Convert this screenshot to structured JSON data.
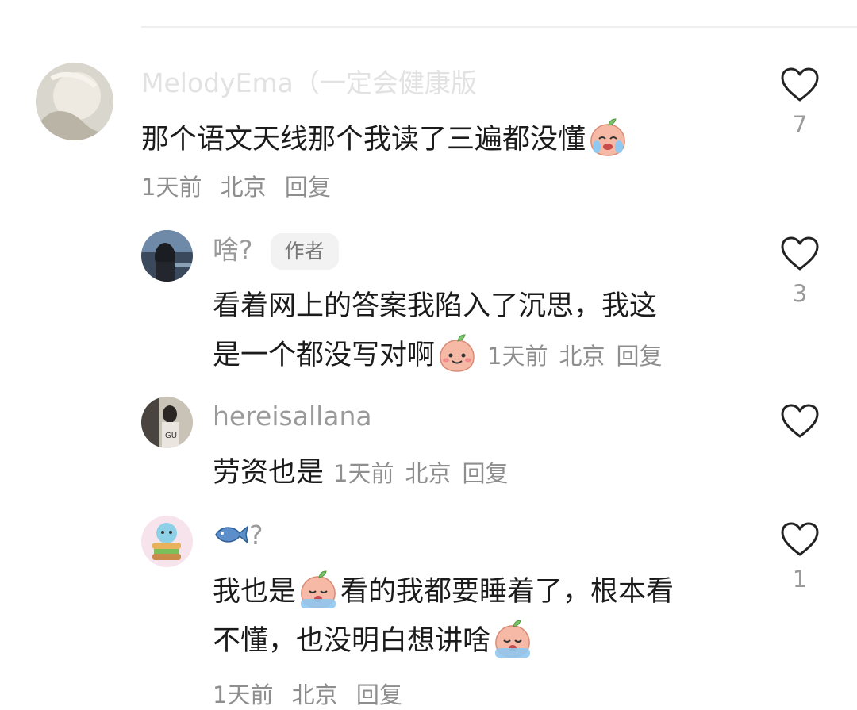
{
  "comments": [
    {
      "author": "MelodyEma（一定会健康版",
      "text": "那个语文天线那个我读了三遍都没懂",
      "time": "1天前",
      "location": "北京",
      "reply_label": "回复",
      "likes": "7",
      "emoji": "crying-peach-emoji"
    },
    {
      "author": "啥?",
      "author_tag": "作者",
      "text_line1": "看着网上的答案我陷入了沉思，我这",
      "text_line2": "是一个都没写对啊",
      "time": "1天前",
      "location": "北京",
      "reply_label": "回复",
      "likes": "3",
      "emoji": "smiling-peach-emoji"
    },
    {
      "author": "hereisallana",
      "text": "劳资也是",
      "time": "1天前",
      "location": "北京",
      "reply_label": "回复",
      "likes": ""
    },
    {
      "author_suffix": "?",
      "author_icon": "fish-emoji",
      "text_line1": "我也是",
      "text_line1_after": "看的我都要睡着了，根本看",
      "text_line2": "不懂，也没明白想讲啥",
      "time": "1天前",
      "location": "北京",
      "reply_label": "回复",
      "likes": "1",
      "emoji": "sobbing-peach-emoji"
    }
  ]
}
